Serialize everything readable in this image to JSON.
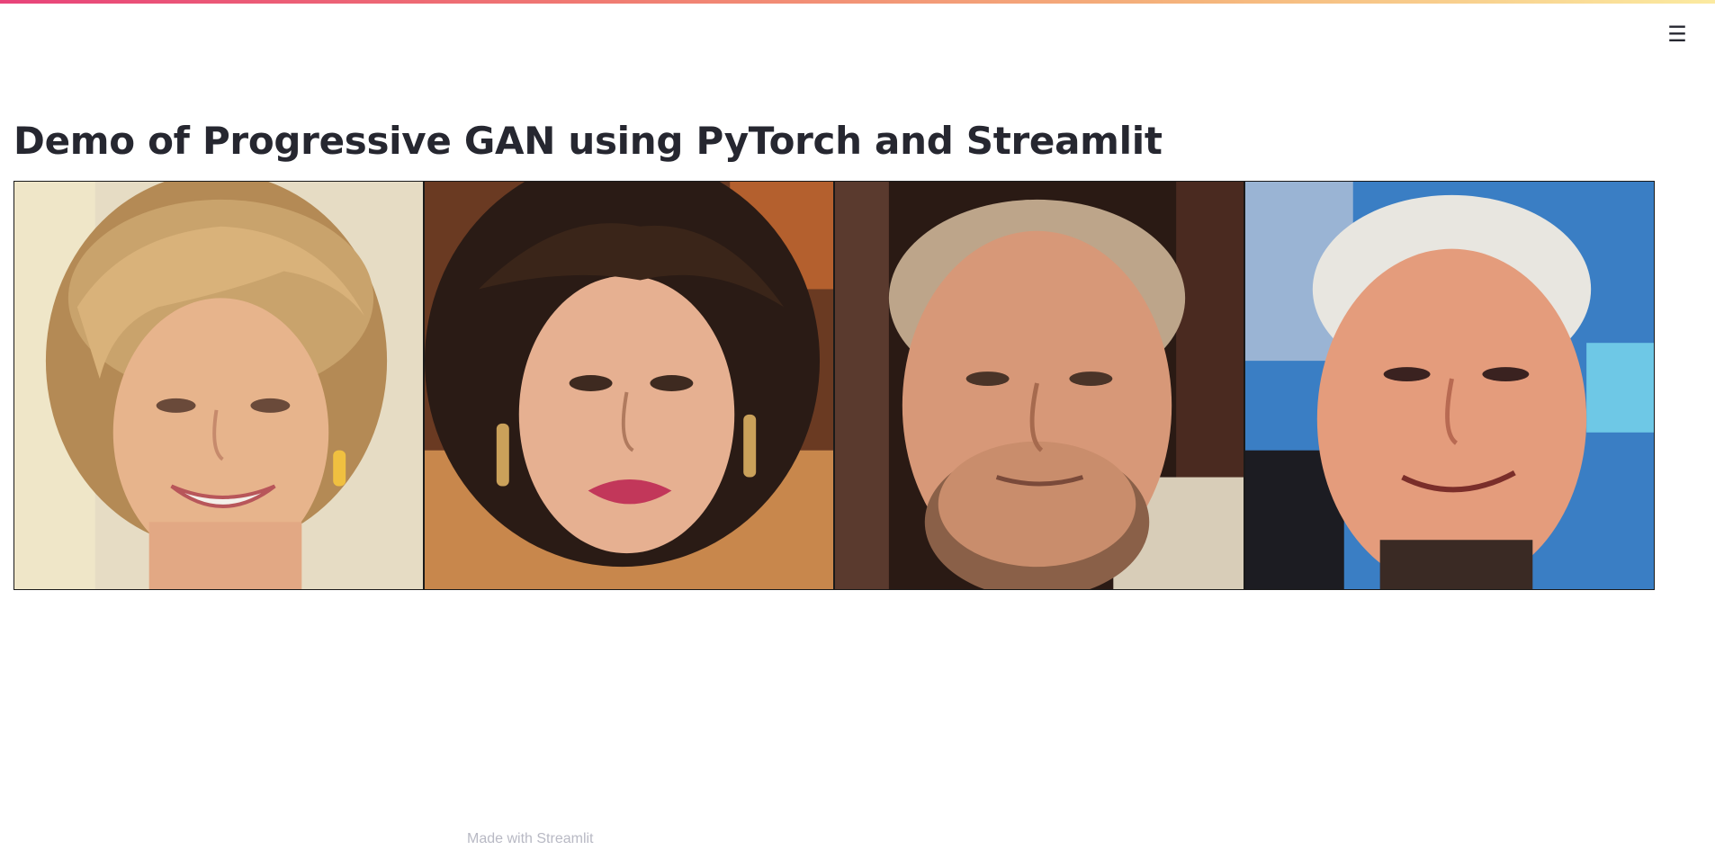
{
  "app": {
    "title": "Demo of Progressive GAN using PyTorch and Streamlit",
    "menu_icon": "hamburger-menu-icon",
    "menu_glyph": "☰",
    "footer": "Made with Streamlit"
  },
  "colors": {
    "decoration_gradient": [
      "#e8437a",
      "#f07b72",
      "#f5b57c",
      "#fbeaa0"
    ],
    "title": "#262730",
    "footer": "#b8b9c4"
  },
  "images": [
    {
      "name": "generated-face-1",
      "description_icon": "face-image"
    },
    {
      "name": "generated-face-2",
      "description_icon": "face-image"
    },
    {
      "name": "generated-face-3",
      "description_icon": "face-image"
    },
    {
      "name": "generated-face-4",
      "description_icon": "face-image"
    }
  ]
}
